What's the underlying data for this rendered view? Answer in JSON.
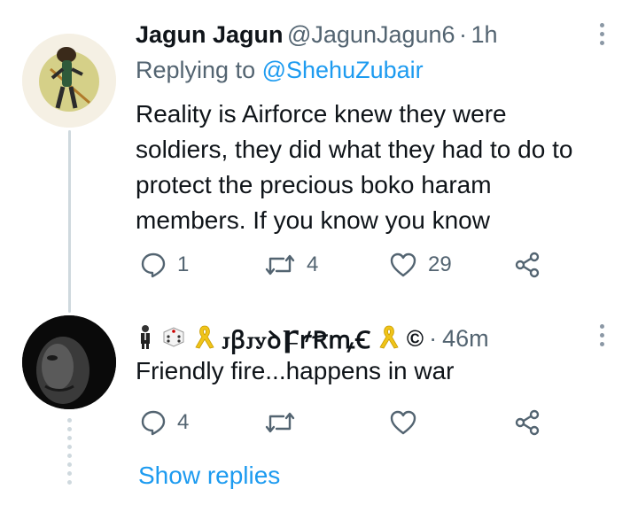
{
  "tweet1": {
    "display_name": "Jagun Jagun",
    "handle": "@JagunJagun6",
    "separator": "·",
    "time": "1h",
    "replying_prefix": "Replying to",
    "replying_to": "@ShehuZubair",
    "body_lines": [
      "Reality is Airforce knew they were",
      "soldiers, they did what they had to do to",
      "protect the precious boko haram",
      "members. If you know you know"
    ],
    "replies": "1",
    "retweets": "4",
    "likes": "29"
  },
  "tweet2": {
    "display_name": "ꭻꞵꭻꭹꝺꝻꝵꞦꝳꞒ",
    "trademark": "©",
    "separator": "·",
    "time": "46m",
    "body": "Friendly fire...happens in war",
    "replies": "4"
  },
  "show_replies_label": "Show replies",
  "icons": {
    "reply": "reply-icon",
    "retweet": "retweet-icon",
    "like": "heart-icon",
    "share": "share-icon",
    "more": "more-vertical-icon"
  },
  "colors": {
    "link": "#1d9bf0",
    "secondary_text": "#536471",
    "primary_text": "#0f1419"
  }
}
